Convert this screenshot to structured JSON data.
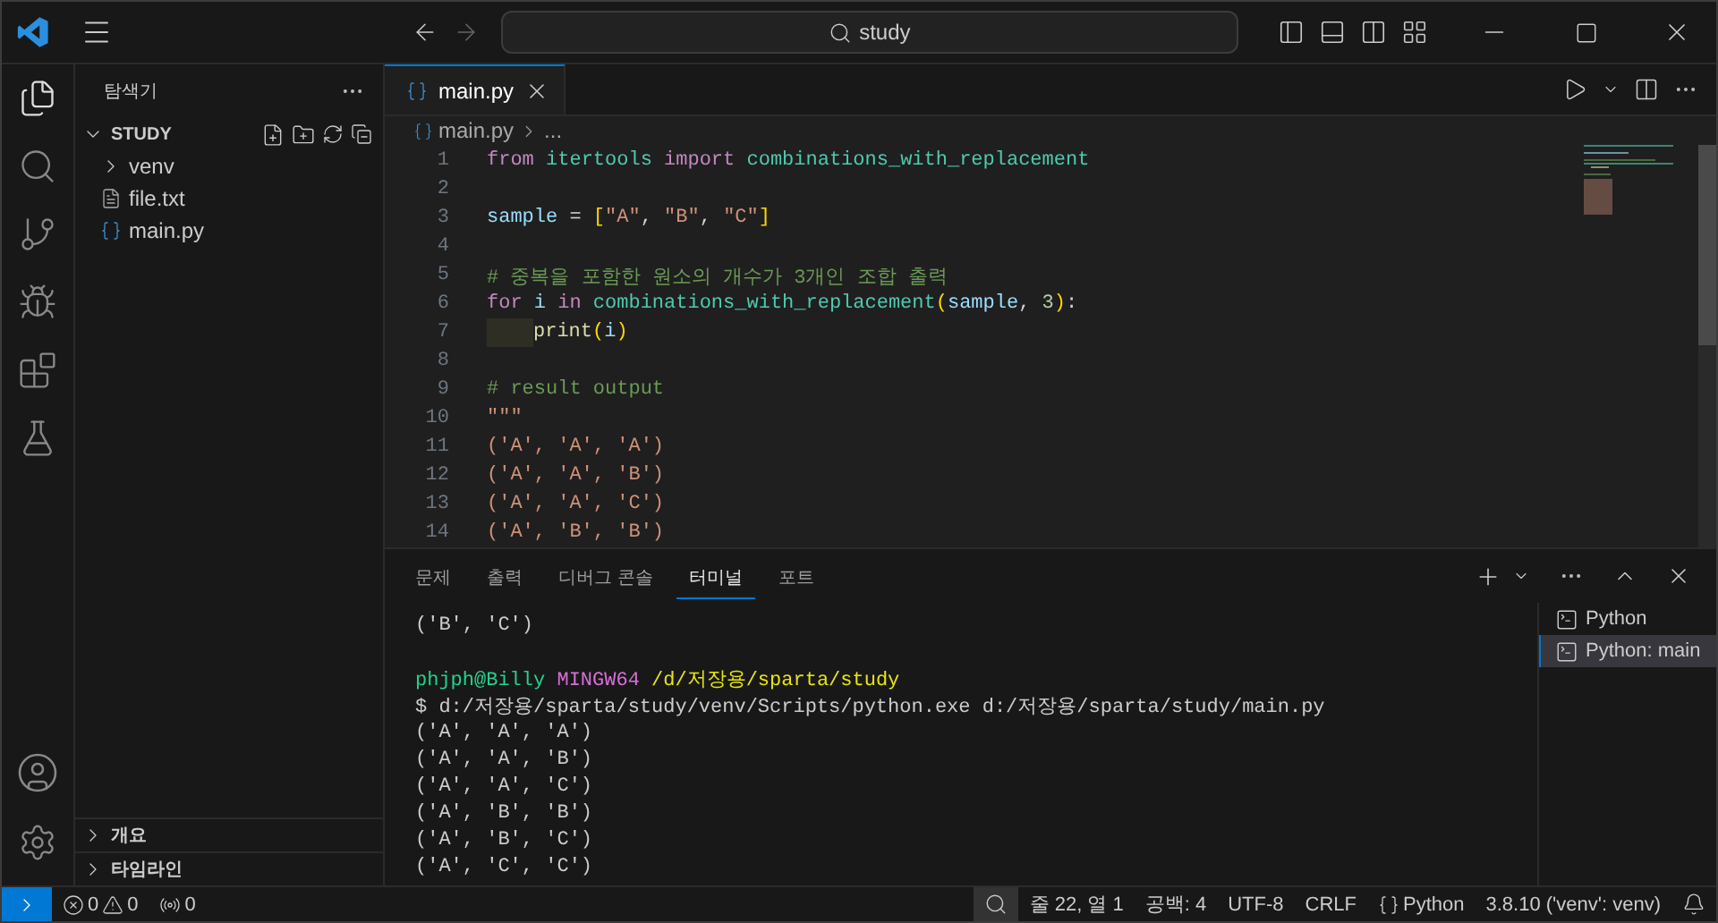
{
  "title_bar": {
    "search": "study"
  },
  "sidebar": {
    "title": "탐색기",
    "root": {
      "label": "STUDY",
      "expanded": true,
      "children": [
        {
          "label": "venv",
          "kind": "folder",
          "expanded": false
        },
        {
          "label": "file.txt",
          "kind": "text"
        },
        {
          "label": "main.py",
          "kind": "python"
        }
      ]
    },
    "sections": [
      {
        "label": "개요",
        "expanded": false
      },
      {
        "label": "타임라인",
        "expanded": false
      }
    ]
  },
  "editor": {
    "tabs": [
      {
        "label": "main.py",
        "selected": true
      }
    ],
    "breadcrumb": [
      "main.py",
      "..."
    ],
    "lines": [
      {
        "number": "1",
        "tokens": [
          {
            "text": "from ",
            "kind": "keyword"
          },
          {
            "text": "itertools ",
            "kind": "module"
          },
          {
            "text": "import ",
            "kind": "keyword"
          },
          {
            "text": "combinations_with_replacement",
            "kind": "module"
          }
        ]
      },
      {
        "number": "2"
      },
      {
        "number": "3",
        "tokens": [
          {
            "text": "sample",
            "kind": "variable"
          },
          {
            "text": " = ",
            "kind": "plain"
          },
          {
            "text": "[",
            "kind": "bracket"
          },
          {
            "text": "\"A\"",
            "kind": "string"
          },
          {
            "text": ", ",
            "kind": "plain"
          },
          {
            "text": "\"B\"",
            "kind": "string"
          },
          {
            "text": ", ",
            "kind": "plain"
          },
          {
            "text": "\"C\"",
            "kind": "string"
          },
          {
            "text": "]",
            "kind": "bracket"
          }
        ]
      },
      {
        "number": "4"
      },
      {
        "number": "5",
        "tokens": [
          {
            "text": "# 중복을 포함한 원소의 개수가 3개인 조합 출력",
            "kind": "comment"
          }
        ]
      },
      {
        "number": "6",
        "tokens": [
          {
            "text": "for ",
            "kind": "keyword"
          },
          {
            "text": "i ",
            "kind": "variable"
          },
          {
            "text": "in ",
            "kind": "keyword"
          },
          {
            "text": "combinations_with_replacement",
            "kind": "module"
          },
          {
            "text": "(",
            "kind": "bracket"
          },
          {
            "text": "sample",
            "kind": "variable"
          },
          {
            "text": ", ",
            "kind": "plain"
          },
          {
            "text": "3",
            "kind": "number"
          },
          {
            "text": ")",
            "kind": "bracket"
          },
          {
            "text": ":",
            "kind": "plain"
          }
        ]
      },
      {
        "number": "7",
        "indent_highlight": true,
        "tokens": [
          {
            "text": "print",
            "kind": "function"
          },
          {
            "text": "(",
            "kind": "bracket"
          },
          {
            "text": "i",
            "kind": "variable"
          },
          {
            "text": ")",
            "kind": "bracket"
          }
        ]
      },
      {
        "number": "8"
      },
      {
        "number": "9",
        "tokens": [
          {
            "text": "# result output",
            "kind": "comment"
          }
        ]
      },
      {
        "number": "10",
        "tokens": [
          {
            "text": "\"\"\"",
            "kind": "string"
          }
        ]
      },
      {
        "number": "11",
        "tokens": [
          {
            "text": "('A', 'A', 'A')",
            "kind": "string"
          }
        ]
      },
      {
        "number": "12",
        "tokens": [
          {
            "text": "('A', 'A', 'B')",
            "kind": "string"
          }
        ]
      },
      {
        "number": "13",
        "tokens": [
          {
            "text": "('A', 'A', 'C')",
            "kind": "string"
          }
        ]
      },
      {
        "number": "14",
        "tokens": [
          {
            "text": "('A', 'B', 'B')",
            "kind": "string"
          }
        ]
      }
    ]
  },
  "panel": {
    "tabs": [
      {
        "label": "문제",
        "selected": false
      },
      {
        "label": "출력",
        "selected": false
      },
      {
        "label": "디버그 콘솔",
        "selected": false
      },
      {
        "label": "터미널",
        "selected": true
      },
      {
        "label": "포트",
        "selected": false
      }
    ],
    "terminal_lines": [
      {
        "segments": [
          {
            "text": "('B', 'C')",
            "kind": "output"
          }
        ]
      },
      {
        "spaced": true,
        "segments": [
          {
            "text": "phjph@Billy ",
            "kind": "user"
          },
          {
            "text": "MINGW64 ",
            "kind": "host"
          },
          {
            "text": "/d/저장용/sparta/study",
            "kind": "path"
          }
        ]
      },
      {
        "segments": [
          {
            "text": "$ d:/저장용/sparta/study/venv/Scripts/python.exe d:/저장용/sparta/study/main.py",
            "kind": "output"
          }
        ]
      },
      {
        "segments": [
          {
            "text": "('A', 'A', 'A')",
            "kind": "output"
          }
        ]
      },
      {
        "segments": [
          {
            "text": "('A', 'A', 'B')",
            "kind": "output"
          }
        ]
      },
      {
        "segments": [
          {
            "text": "('A', 'A', 'C')",
            "kind": "output"
          }
        ]
      },
      {
        "segments": [
          {
            "text": "('A', 'B', 'B')",
            "kind": "output"
          }
        ]
      },
      {
        "segments": [
          {
            "text": "('A', 'B', 'C')",
            "kind": "output"
          }
        ]
      },
      {
        "segments": [
          {
            "text": "('A', 'C', 'C')",
            "kind": "output"
          }
        ]
      }
    ],
    "terminals": [
      {
        "label": "Python",
        "selected": false
      },
      {
        "label": "Python: main",
        "selected": true
      }
    ]
  },
  "status_bar": {
    "errors": "0",
    "warnings": "0",
    "ports": "0",
    "position": "줄 22, 열 1",
    "indent": "공백: 4",
    "encoding": "UTF-8",
    "eol": "CRLF",
    "language": "Python",
    "interpreter": "3.8.10 ('venv': venv)"
  }
}
